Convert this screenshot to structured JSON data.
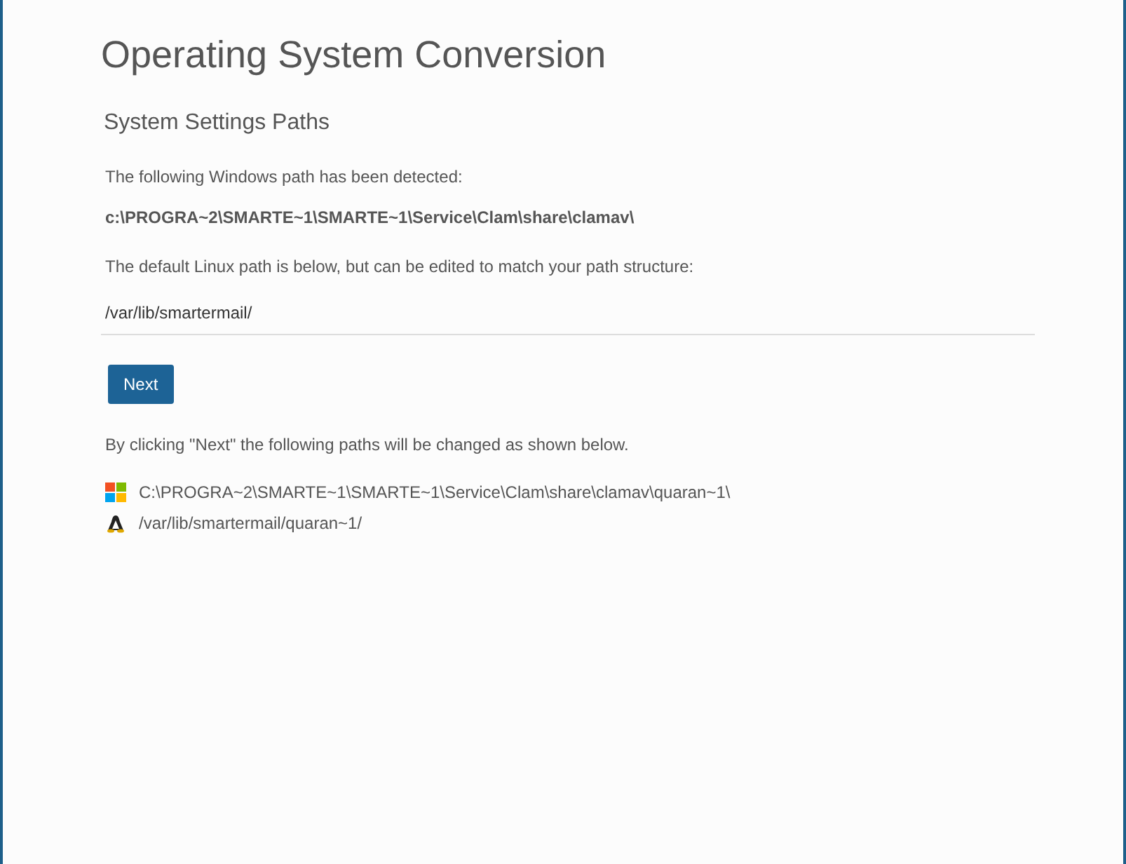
{
  "title": "Operating System Conversion",
  "section_title": "System Settings Paths",
  "detected_label": "The following Windows path has been detected:",
  "detected_path": "c:\\PROGRA~2\\SMARTE~1\\SMARTE~1\\Service\\Clam\\share\\clamav\\",
  "linux_label": "The default Linux path is below, but can be edited to match your path structure:",
  "linux_path_field": {
    "value": "/var/lib/smartermail/"
  },
  "next_button": "Next",
  "changes_label": "By clicking \"Next\" the following paths will be changed as shown below.",
  "paths": [
    {
      "kind": "windows",
      "path": "C:\\PROGRA~2\\SMARTE~1\\SMARTE~1\\Service\\Clam\\share\\clamav\\quaran~1\\"
    },
    {
      "kind": "linux",
      "path": "/var/lib/smartermail/quaran~1/"
    }
  ]
}
